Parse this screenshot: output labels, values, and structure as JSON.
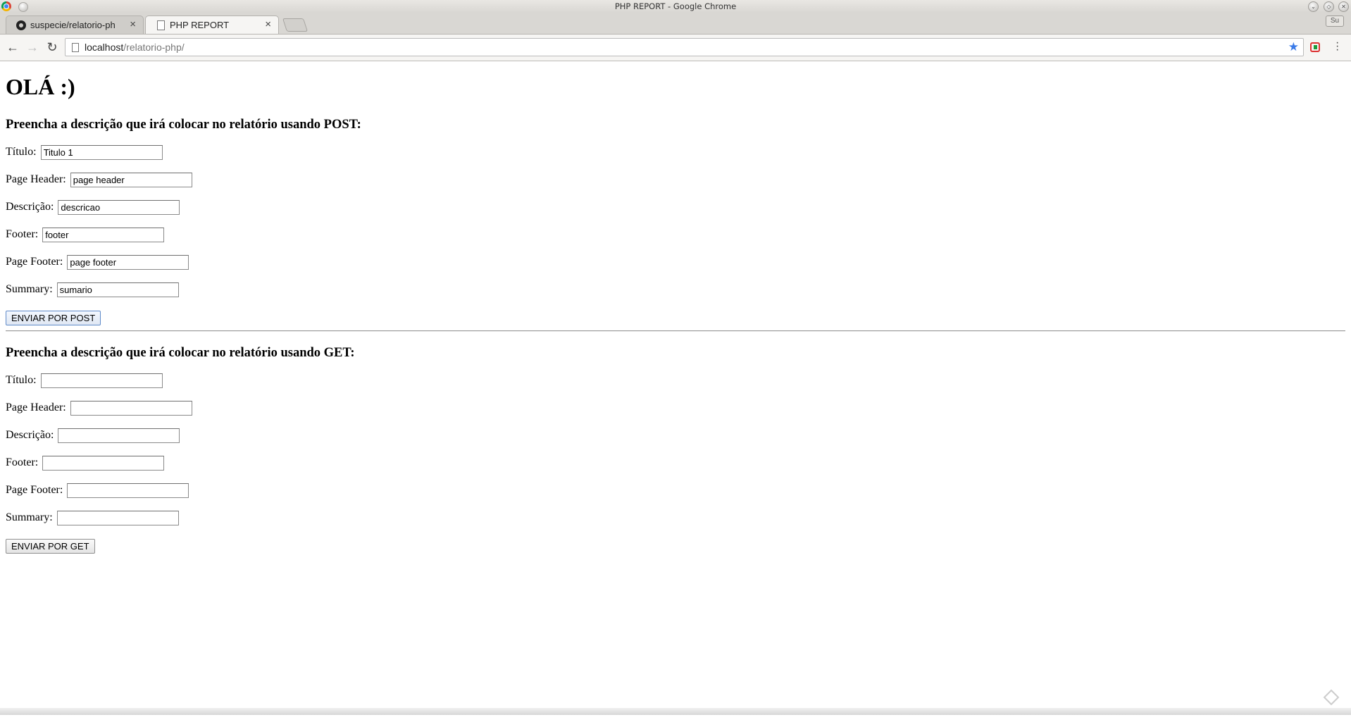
{
  "window": {
    "title": "PHP REPORT - Google Chrome"
  },
  "tabs": [
    {
      "label": "suspecie/relatorio-ph",
      "icon": "github-icon"
    },
    {
      "label": "PHP REPORT",
      "icon": "document-icon"
    }
  ],
  "profile": {
    "label": "Su"
  },
  "toolbar": {
    "url_host": "localhost",
    "url_path": "/relatorio-php/"
  },
  "page": {
    "heading": "OLÁ :)",
    "post_section": {
      "title": "Preencha a descrição que irá colocar no relatório usando POST:",
      "fields": [
        {
          "label": "Título:",
          "value": "Titulo 1"
        },
        {
          "label": "Page Header:",
          "value": "page header"
        },
        {
          "label": "Descrição:",
          "value": "descricao"
        },
        {
          "label": "Footer:",
          "value": "footer"
        },
        {
          "label": "Page Footer:",
          "value": "page footer"
        },
        {
          "label": "Summary:",
          "value": "sumario"
        }
      ],
      "button": "ENVIAR POR POST"
    },
    "get_section": {
      "title": "Preencha a descrição que irá colocar no relatório usando GET:",
      "fields": [
        {
          "label": "Título:",
          "value": ""
        },
        {
          "label": "Page Header:",
          "value": ""
        },
        {
          "label": "Descrição:",
          "value": ""
        },
        {
          "label": "Footer:",
          "value": ""
        },
        {
          "label": "Page Footer:",
          "value": ""
        },
        {
          "label": "Summary:",
          "value": ""
        }
      ],
      "button": "ENVIAR POR GET"
    }
  },
  "colors": {
    "bookmark_star": "#3b7be8",
    "focused_button_border": "#5e8ac9"
  }
}
